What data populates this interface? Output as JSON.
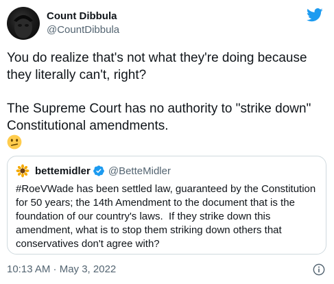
{
  "tweet": {
    "author": {
      "display_name": "Count Dibbula",
      "handle": "@CountDibbula"
    },
    "body_paragraph_1": "You do realize that's not what they're doing because they literally can't, right?",
    "body_paragraph_2": "The Supreme Court has no authority to \"strike down\" Constitutional amendments.",
    "emoji": "confused-face-icon",
    "quoted_tweet": {
      "display_name": "bettemidler",
      "handle": "@BetteMidler",
      "verified": true,
      "text": "#RoeVWade has been settled law, guaranteed by the Constitution for 50 years; the 14th Amendment to the document that is the foundation of our country's laws.  If they strike down this amendment, what is to stop them striking down others that conservatives don't agree with?"
    },
    "timestamp": "10:13 AM · May 3, 2022",
    "icons": {
      "brand": "twitter-logo-icon",
      "info": "info-icon",
      "verified": "verified-badge-icon"
    },
    "colors": {
      "brand_blue": "#1d9bf0",
      "text": "#0f1419",
      "secondary_text": "#536471",
      "border": "#cfd9de"
    }
  }
}
